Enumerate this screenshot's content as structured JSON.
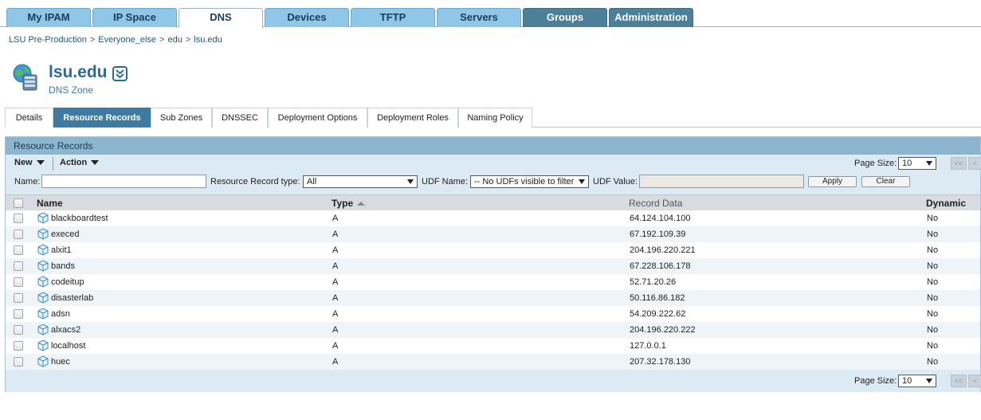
{
  "topnav": {
    "tabs": [
      {
        "label": "My IPAM",
        "style": "light"
      },
      {
        "label": "IP Space",
        "style": "light"
      },
      {
        "label": "DNS",
        "style": "active"
      },
      {
        "label": "Devices",
        "style": "light"
      },
      {
        "label": "TFTP",
        "style": "light"
      },
      {
        "label": "Servers",
        "style": "light"
      },
      {
        "label": "Groups",
        "style": "dark"
      },
      {
        "label": "Administration",
        "style": "dark"
      }
    ]
  },
  "breadcrumb": {
    "items": [
      "LSU Pre-Production",
      "Everyone_else",
      "edu",
      "lsu.edu"
    ],
    "separator": ">"
  },
  "zone": {
    "title": "lsu.edu",
    "subtitle": "DNS Zone",
    "icon": "globe-server-icon",
    "menu_icon": "double-chevron-down-icon"
  },
  "subtabs": [
    {
      "label": "Details",
      "active": false
    },
    {
      "label": "Resource Records",
      "active": true
    },
    {
      "label": "Sub Zones",
      "active": false
    },
    {
      "label": "DNSSEC",
      "active": false
    },
    {
      "label": "Deployment Options",
      "active": false
    },
    {
      "label": "Deployment Roles",
      "active": false
    },
    {
      "label": "Naming Policy",
      "active": false
    }
  ],
  "panel": {
    "title": "Resource Records",
    "toolbar": {
      "new_label": "New",
      "action_label": "Action"
    },
    "filters": {
      "name_label": "Name:",
      "name_value": "",
      "rr_type_label": "Resource Record type:",
      "rr_type_value": "All",
      "udf_name_label": "UDF Name:",
      "udf_name_value": "-- No UDFs visible to filter",
      "udf_value_label": "UDF Value:",
      "udf_value_value": "",
      "apply_label": "Apply",
      "clear_label": "Clear"
    },
    "page_size_label": "Page Size:",
    "page_size_value": "10",
    "pager_prev_first": "<<",
    "pager_prev": "<",
    "columns": {
      "name": "Name",
      "type": "Type",
      "record_data": "Record Data",
      "dynamic": "Dynamic"
    },
    "rows": [
      {
        "name": "blackboardtest",
        "type": "A",
        "data": "64.124.104.100",
        "dynamic": "No"
      },
      {
        "name": "execed",
        "type": "A",
        "data": "67.192.109.39",
        "dynamic": "No"
      },
      {
        "name": "alxit1",
        "type": "A",
        "data": "204.196.220.221",
        "dynamic": "No"
      },
      {
        "name": "bands",
        "type": "A",
        "data": "67.228.106.178",
        "dynamic": "No"
      },
      {
        "name": "codeitup",
        "type": "A",
        "data": "52.71.20.26",
        "dynamic": "No"
      },
      {
        "name": "disasterlab",
        "type": "A",
        "data": "50.116.86.182",
        "dynamic": "No"
      },
      {
        "name": "adsn",
        "type": "A",
        "data": "54.209.222.62",
        "dynamic": "No"
      },
      {
        "name": "alxacs2",
        "type": "A",
        "data": "204.196.220.222",
        "dynamic": "No"
      },
      {
        "name": "localhost",
        "type": "A",
        "data": "127.0.0.1",
        "dynamic": "No"
      },
      {
        "name": "huec",
        "type": "A",
        "data": "207.32.178.130",
        "dynamic": "No"
      }
    ]
  },
  "colors": {
    "tab_light": "#8fc7e8",
    "tab_dark": "#4b7f9a",
    "accent": "#3f7aa0",
    "panel_header": "#8cb6cf"
  }
}
